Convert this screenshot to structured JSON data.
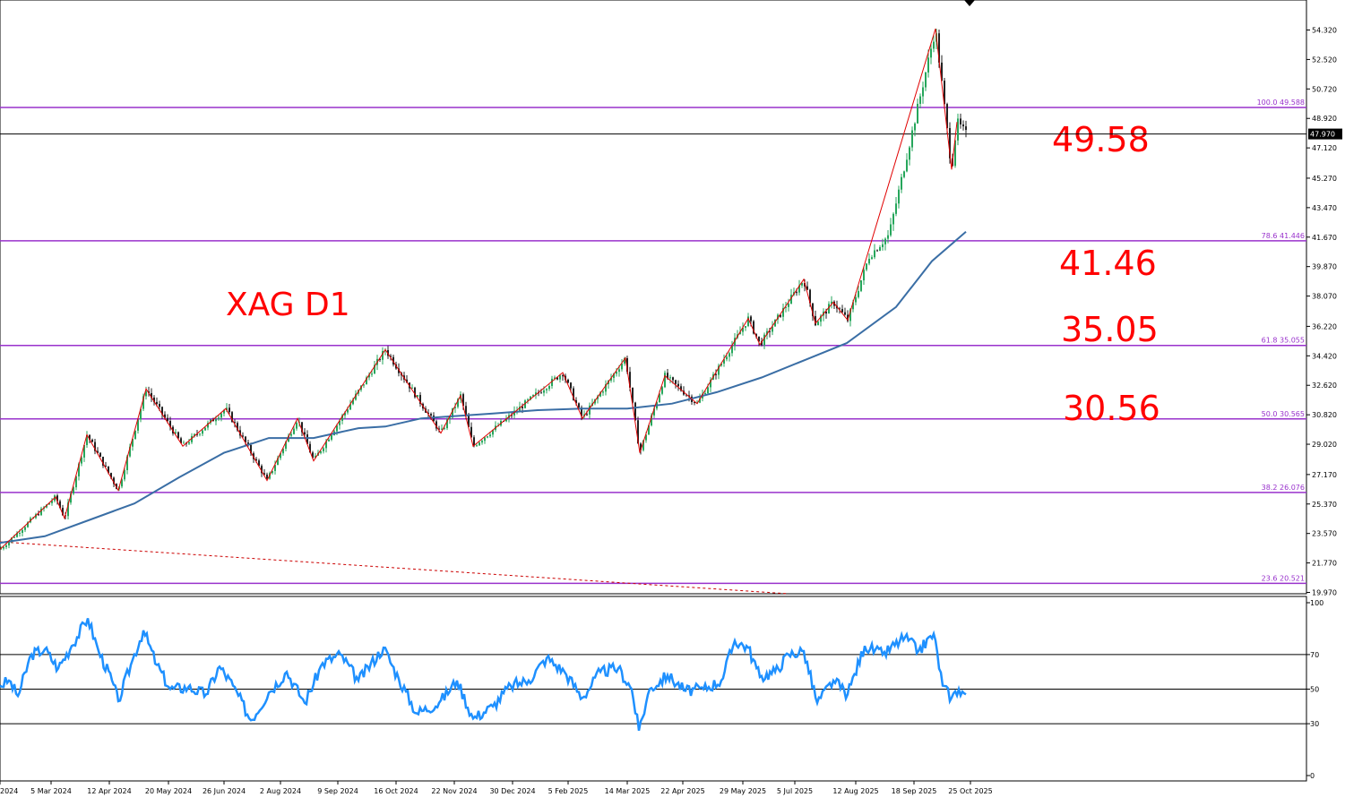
{
  "chart_data": [
    {
      "type": "candlestick",
      "symbol_label": "XAG D1",
      "price_axis": {
        "ylim": [
          19.97,
          56.12
        ],
        "tick_labels": [
          "54.320",
          "52.520",
          "50.720",
          "48.920",
          "47.120",
          "45.270",
          "43.470",
          "41.670",
          "39.870",
          "38.070",
          "36.220",
          "34.420",
          "32.620",
          "30.820",
          "29.020",
          "27.170",
          "25.370",
          "23.570",
          "21.770",
          "19.970"
        ],
        "ticks": [
          54.32,
          52.52,
          50.72,
          48.92,
          47.12,
          45.27,
          43.47,
          41.67,
          39.87,
          38.07,
          36.22,
          34.42,
          32.62,
          30.82,
          29.02,
          27.17,
          25.37,
          23.57,
          21.77,
          19.97
        ]
      },
      "current_price": {
        "value": 47.97,
        "label": "47.970"
      },
      "fibonacci_levels": [
        {
          "value": 49.588,
          "label": "100.0 49.588",
          "note": "49.58"
        },
        {
          "value": 41.446,
          "label": "78.6 41.446",
          "note": "41.46"
        },
        {
          "value": 35.055,
          "label": "61.8 35.055",
          "note": "35.05"
        },
        {
          "value": 30.565,
          "label": "50.0 30.565",
          "note": "30.56"
        },
        {
          "value": 26.076,
          "label": "38.2 26.076",
          "note": ""
        },
        {
          "value": 20.521,
          "label": "23.6 20.521",
          "note": ""
        }
      ],
      "zigzag": [
        {
          "x": 0,
          "y": 22.6
        },
        {
          "x": 62,
          "y": 25.8
        },
        {
          "x": 72,
          "y": 24.5
        },
        {
          "x": 97,
          "y": 29.6
        },
        {
          "x": 132,
          "y": 26.2
        },
        {
          "x": 163,
          "y": 32.4
        },
        {
          "x": 204,
          "y": 28.9
        },
        {
          "x": 252,
          "y": 31.2
        },
        {
          "x": 298,
          "y": 26.8
        },
        {
          "x": 332,
          "y": 30.6
        },
        {
          "x": 350,
          "y": 28.0
        },
        {
          "x": 430,
          "y": 34.8
        },
        {
          "x": 492,
          "y": 29.7
        },
        {
          "x": 514,
          "y": 32.0
        },
        {
          "x": 528,
          "y": 28.9
        },
        {
          "x": 628,
          "y": 33.4
        },
        {
          "x": 650,
          "y": 30.6
        },
        {
          "x": 698,
          "y": 34.3
        },
        {
          "x": 714,
          "y": 28.5
        },
        {
          "x": 742,
          "y": 33.2
        },
        {
          "x": 778,
          "y": 31.5
        },
        {
          "x": 835,
          "y": 36.7
        },
        {
          "x": 848,
          "y": 35.1
        },
        {
          "x": 897,
          "y": 39.1
        },
        {
          "x": 910,
          "y": 36.4
        },
        {
          "x": 930,
          "y": 37.7
        },
        {
          "x": 946,
          "y": 36.6
        },
        {
          "x": 1044,
          "y": 54.4
        },
        {
          "x": 1062,
          "y": 45.8
        },
        {
          "x": 1068,
          "y": 48.7
        }
      ],
      "moving_average": [
        {
          "x": 0,
          "y": 23.0
        },
        {
          "x": 50,
          "y": 23.4
        },
        {
          "x": 100,
          "y": 24.4
        },
        {
          "x": 150,
          "y": 25.4
        },
        {
          "x": 200,
          "y": 27.0
        },
        {
          "x": 250,
          "y": 28.5
        },
        {
          "x": 300,
          "y": 29.4
        },
        {
          "x": 350,
          "y": 29.4
        },
        {
          "x": 400,
          "y": 30.0
        },
        {
          "x": 430,
          "y": 30.1
        },
        {
          "x": 470,
          "y": 30.6
        },
        {
          "x": 550,
          "y": 30.9
        },
        {
          "x": 600,
          "y": 31.1
        },
        {
          "x": 650,
          "y": 31.2
        },
        {
          "x": 700,
          "y": 31.2
        },
        {
          "x": 750,
          "y": 31.5
        },
        {
          "x": 800,
          "y": 32.2
        },
        {
          "x": 850,
          "y": 33.1
        },
        {
          "x": 900,
          "y": 34.2
        },
        {
          "x": 945,
          "y": 35.2
        },
        {
          "x": 1000,
          "y": 37.4
        },
        {
          "x": 1040,
          "y": 40.2
        },
        {
          "x": 1078,
          "y": 42.0
        }
      ],
      "price_path": [
        {
          "x": 0,
          "y": 22.6
        },
        {
          "x": 62,
          "y": 25.8
        },
        {
          "x": 72,
          "y": 24.5
        },
        {
          "x": 97,
          "y": 29.6
        },
        {
          "x": 132,
          "y": 26.2
        },
        {
          "x": 163,
          "y": 32.4
        },
        {
          "x": 204,
          "y": 28.9
        },
        {
          "x": 252,
          "y": 31.2
        },
        {
          "x": 298,
          "y": 26.8
        },
        {
          "x": 332,
          "y": 30.6
        },
        {
          "x": 350,
          "y": 28.0
        },
        {
          "x": 430,
          "y": 34.8
        },
        {
          "x": 492,
          "y": 29.7
        },
        {
          "x": 514,
          "y": 32.0
        },
        {
          "x": 528,
          "y": 28.9
        },
        {
          "x": 628,
          "y": 33.4
        },
        {
          "x": 650,
          "y": 30.6
        },
        {
          "x": 698,
          "y": 34.3
        },
        {
          "x": 714,
          "y": 28.5
        },
        {
          "x": 742,
          "y": 33.2
        },
        {
          "x": 778,
          "y": 31.5
        },
        {
          "x": 835,
          "y": 36.7
        },
        {
          "x": 848,
          "y": 35.1
        },
        {
          "x": 897,
          "y": 39.1
        },
        {
          "x": 910,
          "y": 36.4
        },
        {
          "x": 930,
          "y": 37.7
        },
        {
          "x": 946,
          "y": 36.6
        },
        {
          "x": 970,
          "y": 40.5
        },
        {
          "x": 992,
          "y": 41.8
        },
        {
          "x": 1044,
          "y": 54.4
        },
        {
          "x": 1062,
          "y": 45.8
        },
        {
          "x": 1068,
          "y": 48.7
        },
        {
          "x": 1078,
          "y": 47.97
        }
      ],
      "x_axis": {
        "tick_labels": [
          "2024",
          "5 Mar 2024",
          "12 Apr 2024",
          "20 May 2024",
          "26 Jun 2024",
          "2 Aug 2024",
          "9 Sep 2024",
          "16 Oct 2024",
          "22 Nov 2024",
          "30 Dec 2024",
          "5 Feb 2025",
          "14 Mar 2025",
          "22 Apr 2025",
          "29 May 2025",
          "5 Jul 2025",
          "12 Aug 2025",
          "18 Sep 2025",
          "25 Oct 2025"
        ],
        "tick_index": [
          0,
          57,
          122,
          188,
          250,
          313,
          377,
          442,
          507,
          572,
          634,
          700,
          762,
          829,
          887,
          955,
          1020,
          1083
        ]
      },
      "grid": false
    },
    {
      "type": "line",
      "indicator": "RSI",
      "ylim": [
        0,
        100
      ],
      "tick_labels": [
        "100",
        "70",
        "50",
        "30",
        "0"
      ],
      "ticks": [
        100,
        70,
        50,
        30,
        0
      ],
      "levels": [
        70,
        50,
        30
      ],
      "series": [
        {
          "x": 0,
          "y": 52
        },
        {
          "x": 10,
          "y": 55
        },
        {
          "x": 20,
          "y": 46
        },
        {
          "x": 35,
          "y": 70
        },
        {
          "x": 50,
          "y": 73
        },
        {
          "x": 65,
          "y": 62
        },
        {
          "x": 80,
          "y": 75
        },
        {
          "x": 98,
          "y": 91
        },
        {
          "x": 110,
          "y": 72
        },
        {
          "x": 125,
          "y": 55
        },
        {
          "x": 132,
          "y": 43
        },
        {
          "x": 148,
          "y": 67
        },
        {
          "x": 160,
          "y": 84
        },
        {
          "x": 175,
          "y": 64
        },
        {
          "x": 190,
          "y": 50
        },
        {
          "x": 210,
          "y": 51
        },
        {
          "x": 230,
          "y": 47
        },
        {
          "x": 245,
          "y": 63
        },
        {
          "x": 260,
          "y": 52
        },
        {
          "x": 280,
          "y": 32
        },
        {
          "x": 300,
          "y": 48
        },
        {
          "x": 320,
          "y": 60
        },
        {
          "x": 340,
          "y": 42
        },
        {
          "x": 360,
          "y": 65
        },
        {
          "x": 380,
          "y": 70
        },
        {
          "x": 400,
          "y": 55
        },
        {
          "x": 428,
          "y": 74
        },
        {
          "x": 445,
          "y": 56
        },
        {
          "x": 465,
          "y": 36
        },
        {
          "x": 490,
          "y": 42
        },
        {
          "x": 510,
          "y": 55
        },
        {
          "x": 528,
          "y": 33
        },
        {
          "x": 550,
          "y": 40
        },
        {
          "x": 570,
          "y": 52
        },
        {
          "x": 590,
          "y": 55
        },
        {
          "x": 610,
          "y": 68
        },
        {
          "x": 630,
          "y": 60
        },
        {
          "x": 650,
          "y": 45
        },
        {
          "x": 670,
          "y": 60
        },
        {
          "x": 690,
          "y": 62
        },
        {
          "x": 705,
          "y": 50
        },
        {
          "x": 713,
          "y": 26
        },
        {
          "x": 725,
          "y": 50
        },
        {
          "x": 745,
          "y": 58
        },
        {
          "x": 765,
          "y": 49
        },
        {
          "x": 785,
          "y": 50
        },
        {
          "x": 805,
          "y": 55
        },
        {
          "x": 820,
          "y": 78
        },
        {
          "x": 835,
          "y": 74
        },
        {
          "x": 848,
          "y": 57
        },
        {
          "x": 865,
          "y": 60
        },
        {
          "x": 880,
          "y": 70
        },
        {
          "x": 897,
          "y": 72
        },
        {
          "x": 912,
          "y": 42
        },
        {
          "x": 930,
          "y": 55
        },
        {
          "x": 946,
          "y": 47
        },
        {
          "x": 965,
          "y": 75
        },
        {
          "x": 985,
          "y": 70
        },
        {
          "x": 1010,
          "y": 80
        },
        {
          "x": 1025,
          "y": 72
        },
        {
          "x": 1042,
          "y": 82
        },
        {
          "x": 1052,
          "y": 52
        },
        {
          "x": 1062,
          "y": 45
        },
        {
          "x": 1070,
          "y": 50
        },
        {
          "x": 1078,
          "y": 47
        }
      ]
    }
  ]
}
